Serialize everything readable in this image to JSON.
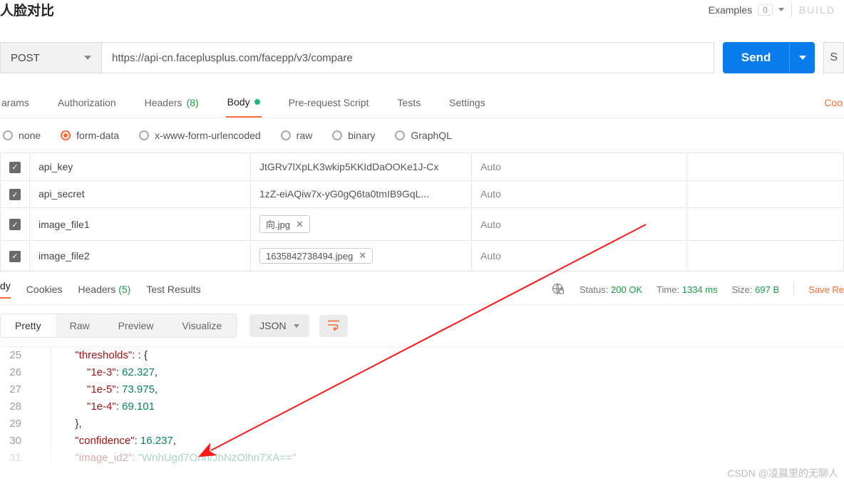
{
  "header": {
    "title": "人脸对比",
    "examples_label": "Examples",
    "examples_count": "0",
    "build_label": "BUILD"
  },
  "request": {
    "method": "POST",
    "url": "https://api-cn.faceplusplus.com/facepp/v3/compare",
    "send_label": "Send",
    "save_label": "S"
  },
  "tabs": {
    "params": "arams",
    "auth": "Authorization",
    "headers": "Headers",
    "headers_count": "(8)",
    "body": "Body",
    "prereq": "Pre-request Script",
    "tests": "Tests",
    "settings": "Settings",
    "cookies_right": "Coo"
  },
  "body_types": {
    "none": "none",
    "formdata": "form-data",
    "xwww": "x-www-form-urlencoded",
    "raw": "raw",
    "binary": "binary",
    "graphql": "GraphQL"
  },
  "params_table": [
    {
      "key": "api_key",
      "value_text": "JtGRv7lXpLK3wkip5KKIdDaOOKe1J-Cx",
      "desc": "Auto"
    },
    {
      "key": "api_secret",
      "value_text": "1zZ-eiAQiw7x-yG0gQ6ta0tmIB9GqL...",
      "desc": "Auto"
    },
    {
      "key": "image_file1",
      "value_file": "向.jpg",
      "desc": "Auto"
    },
    {
      "key": "image_file2",
      "value_file": "1635842738494.jpeg",
      "desc": "Auto"
    }
  ],
  "resp_tabs": {
    "body": "dy",
    "cookies": "Cookies",
    "headers": "Headers",
    "headers_count": "(5)",
    "test_results": "Test Results"
  },
  "resp_status": {
    "status_label": "Status:",
    "status_value": "200 OK",
    "time_label": "Time:",
    "time_value": "1334 ms",
    "size_label": "Size:",
    "size_value": "697 B",
    "save_response": "Save Re"
  },
  "view": {
    "pretty": "Pretty",
    "raw": "Raw",
    "preview": "Preview",
    "visualize": "Visualize",
    "json": "JSON"
  },
  "json_lines": [
    {
      "n": "25",
      "indent": "        ",
      "key": "thresholds",
      "after": ": {"
    },
    {
      "n": "26",
      "indent": "            ",
      "key": "1e-3",
      "num": "62.327",
      "comma": true
    },
    {
      "n": "27",
      "indent": "            ",
      "key": "1e-5",
      "num": "73.975",
      "comma": true
    },
    {
      "n": "28",
      "indent": "            ",
      "key": "1e-4",
      "num": "69.101"
    },
    {
      "n": "29",
      "indent": "        ",
      "raw": "},"
    },
    {
      "n": "30",
      "indent": "        ",
      "key": "confidence",
      "num": "16.237",
      "comma": true
    },
    {
      "n": "31",
      "indent": "        ",
      "key": "image_id2",
      "str": "WnhUgd7Onn/JhNzOlhn7XA==",
      "faded": true
    }
  ],
  "watermark": "CSDN @凌晨里的无聊人"
}
